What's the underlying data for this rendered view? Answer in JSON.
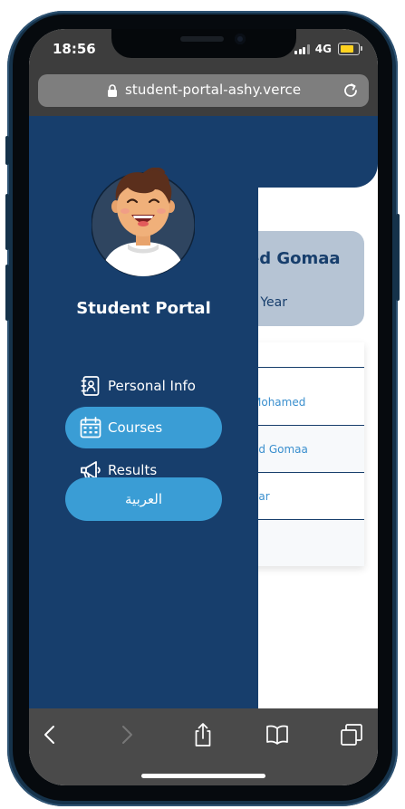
{
  "status_bar": {
    "time": "18:56",
    "network": "4G",
    "icons": [
      "signal-icon",
      "battery-icon"
    ]
  },
  "browser": {
    "url": "student-portal-ashy.verce",
    "icons": [
      "lock-icon",
      "reload-icon"
    ],
    "toolbar_icons": [
      "back-icon",
      "forward-icon",
      "share-icon",
      "bookmarks-icon",
      "tabs-icon"
    ]
  },
  "sidebar": {
    "title": "Student Portal",
    "items": [
      {
        "label": "Personal Info",
        "icon": "contacts-book-icon",
        "active": false
      },
      {
        "label": "Courses",
        "icon": "calendar-icon",
        "active": true
      },
      {
        "label": "Results",
        "icon": "megaphone-icon",
        "active": false
      }
    ],
    "language_button": "العربية"
  },
  "page": {
    "close_icon": "close-icon",
    "card": {
      "name_fragment": "ed Gomaa",
      "year_fragment": "d Year"
    },
    "table_rows": [
      "Mohamed",
      "ed Gomaa",
      "ear"
    ]
  },
  "colors": {
    "navy": "#173e6c",
    "accent": "#3a9dd5",
    "card": "#b6c4d4"
  }
}
